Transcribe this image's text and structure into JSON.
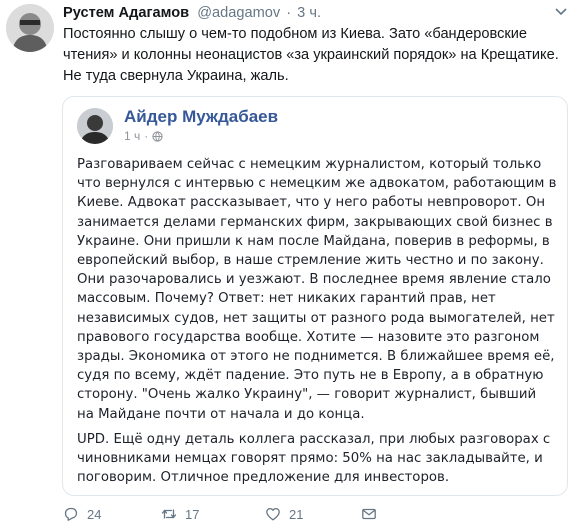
{
  "tweet": {
    "author_name": "Рустем Адагамов",
    "author_handle": "@adagamov",
    "separator": "·",
    "time": "3 ч.",
    "text": "Постоянно слышу о чем-то подобном из Киева. Зато «бандеровские чтения» и колонны неонацистов «за украинский порядок» на Крещатике. Не туда свернула Украина, жаль."
  },
  "quote": {
    "author_name": "Айдер Муждабаев",
    "time": "1 ч",
    "separator": "·",
    "paragraphs": [
      "Разговариваем сейчас с немецким журналистом, который только что вернулся с интервью с немецким же адвокатом, работающим в Киеве. Адвокат рассказывает, что у него работы невпроворот. Он занимается делами германских фирм, закрывающих свой бизнес в Украине. Они пришли к нам после Майдана, поверив в реформы, в европейский выбор, в наше стремление жить честно и по закону. Они разочаровались и уезжают. В последнее время явление стало массовым. Почему? Ответ: нет никаких гарантий прав, нет независимых судов, нет защиты от разного рода вымогателей, нет правового государства вообще. Хотите — назовите это разгоном зрады. Экономика от этого не поднимется. В ближайшее время её, судя по всему, ждёт падение. Это путь не в Европу, а в обратную сторону. \"Очень жалко Украину\", — говорит журналист, бывший на Майдане почти от начала и до конца.",
      "UPD. Ещё одну деталь коллега рассказал, при любых разговорах с чиновниками немцах говорят прямо: 50% на нас закладывайте, и поговорим. Отличное предложение для инвесторов."
    ]
  },
  "actions": {
    "reply_count": "24",
    "retweet_count": "17",
    "like_count": "21"
  },
  "icons": {
    "reply": "reply-icon",
    "retweet": "retweet-icon",
    "like": "heart-icon",
    "dm": "envelope-icon",
    "more": "chevron-down-icon",
    "privacy": "globe-icon"
  },
  "colors": {
    "text": "#14171a",
    "secondary": "#657786",
    "facebook_name": "#365899",
    "border": "#e1e8ed"
  }
}
